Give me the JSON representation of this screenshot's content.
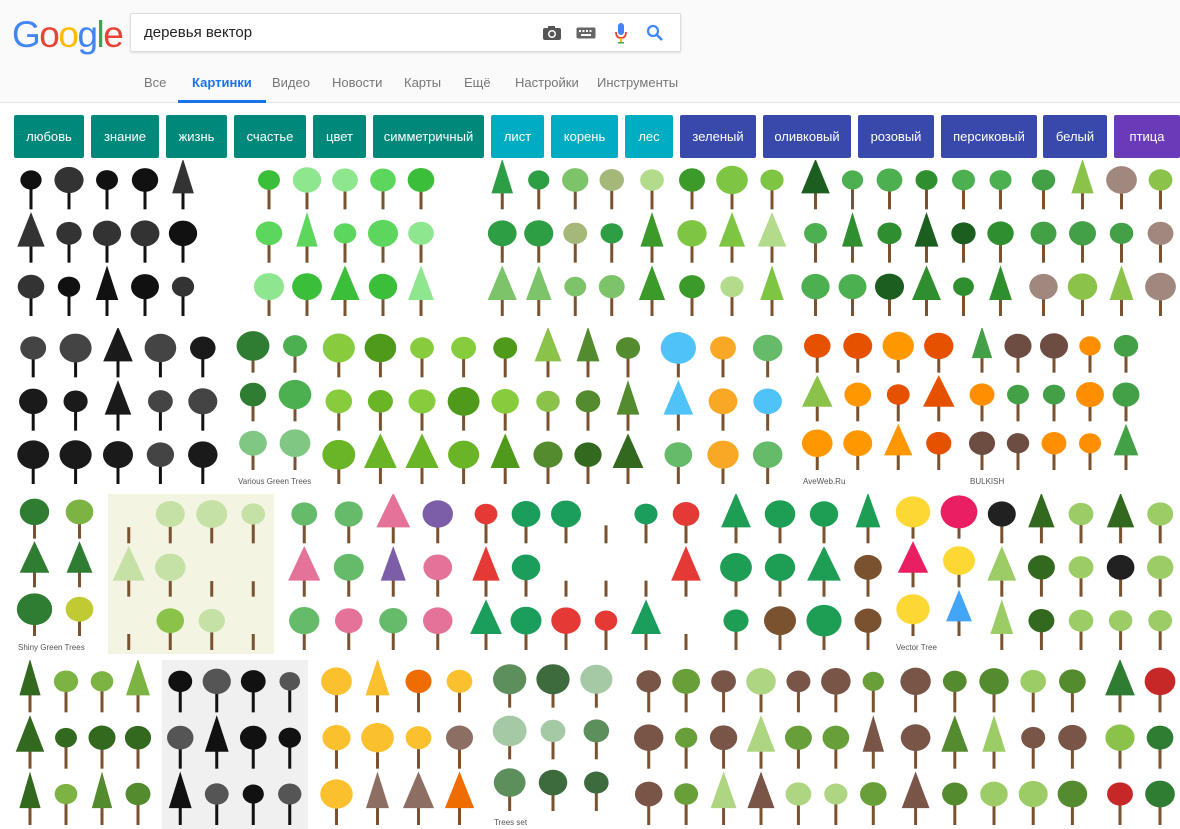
{
  "logo": {
    "letters": [
      "G",
      "o",
      "o",
      "g",
      "l",
      "e"
    ],
    "colors": [
      "#4285F4",
      "#EA4335",
      "#FBBC05",
      "#4285F4",
      "#34A853",
      "#EA4335"
    ]
  },
  "search": {
    "query": "деревья вектор",
    "camera_icon": "camera-icon",
    "keyboard_icon": "keyboard-icon",
    "mic_icon": "microphone-icon",
    "search_icon": "search-icon"
  },
  "tabs": [
    {
      "label": "Все",
      "active": false
    },
    {
      "label": "Картинки",
      "active": true
    },
    {
      "label": "Видео",
      "active": false
    },
    {
      "label": "Новости",
      "active": false
    },
    {
      "label": "Карты",
      "active": false
    },
    {
      "label": "Ещё",
      "active": false
    },
    {
      "label": "Настройки",
      "active": false
    },
    {
      "label": "Инструменты",
      "active": false
    }
  ],
  "chips": [
    {
      "label": "любовь",
      "color": "#00897B"
    },
    {
      "label": "знание",
      "color": "#00897B"
    },
    {
      "label": "жизнь",
      "color": "#00897B"
    },
    {
      "label": "счастье",
      "color": "#00897B"
    },
    {
      "label": "цвет",
      "color": "#00897B"
    },
    {
      "label": "симметричный",
      "color": "#00897B"
    },
    {
      "label": "лист",
      "color": "#00ACC1"
    },
    {
      "label": "корень",
      "color": "#00ACC1"
    },
    {
      "label": "лес",
      "color": "#00ACC1"
    },
    {
      "label": "зеленый",
      "color": "#3949AB"
    },
    {
      "label": "оливковый",
      "color": "#3949AB"
    },
    {
      "label": "розовый",
      "color": "#3949AB"
    },
    {
      "label": "персиковый",
      "color": "#3949AB"
    },
    {
      "label": "белый",
      "color": "#3949AB"
    },
    {
      "label": "птица",
      "color": "#6A3BB8"
    }
  ],
  "thumbnails": [
    {
      "style": "silhouette-black",
      "palette": [
        "#111111",
        "#333333"
      ],
      "caption": ""
    },
    {
      "style": "cartoon-green",
      "palette": [
        "#5cd65c",
        "#3bbf3b",
        "#8ee68e"
      ],
      "caption": ""
    },
    {
      "style": "mixed-green",
      "palette": [
        "#2e9e45",
        "#7cc36a",
        "#a4b87a"
      ],
      "caption": ""
    },
    {
      "style": "willow-green",
      "palette": [
        "#7dc542",
        "#3c9a2a",
        "#b2dc8b"
      ],
      "caption": ""
    },
    {
      "style": "many-green",
      "palette": [
        "#2f8f2f",
        "#4caf50",
        "#1b5e20"
      ],
      "caption": ""
    },
    {
      "style": "bonsai-green",
      "palette": [
        "#43a047",
        "#8bc34a",
        "#a1887f"
      ],
      "caption": ""
    },
    {
      "style": "silhouette-reflect",
      "palette": [
        "#1a1a1a",
        "#444444"
      ],
      "caption": ""
    },
    {
      "style": "small-green",
      "palette": [
        "#4caf50",
        "#2e7d32",
        "#81c784"
      ],
      "caption": "Various Green Trees"
    },
    {
      "style": "lime-green",
      "palette": [
        "#6ab526",
        "#4f9a1a",
        "#86cc3c"
      ],
      "caption": ""
    },
    {
      "style": "grid-green",
      "palette": [
        "#558b2f",
        "#8bc34a",
        "#33691e"
      ],
      "caption": ""
    },
    {
      "style": "autumn-mix",
      "palette": [
        "#f9a825",
        "#66bb6a",
        "#4fc3f7"
      ],
      "caption": ""
    },
    {
      "style": "autumn-green",
      "palette": [
        "#8bc34a",
        "#ff9800",
        "#e65100"
      ],
      "caption": "AveWeb.Ru"
    },
    {
      "style": "seasons",
      "palette": [
        "#6d4c41",
        "#43a047",
        "#ff8f00"
      ],
      "caption": "BULKISH"
    },
    {
      "style": "shiny-green",
      "palette": [
        "#7cb342",
        "#2e7d32",
        "#c0ca33"
      ],
      "caption": "Shiny Green Trees"
    },
    {
      "style": "flat-cream",
      "palette": [
        "#8bc34a",
        "#c5e1a5",
        "#f4f4e3"
      ],
      "caption": ""
    },
    {
      "style": "pink-purple",
      "palette": [
        "#e57399",
        "#7b5ea7",
        "#66bb6a"
      ],
      "caption": ""
    },
    {
      "style": "emblem-green",
      "palette": [
        "#1b9e5b",
        "#e53935",
        "#ffffff"
      ],
      "caption": ""
    },
    {
      "style": "green-tree-big",
      "palette": [
        "#1e9e55",
        "#7a5230"
      ],
      "caption": ""
    },
    {
      "style": "colorful-dots",
      "palette": [
        "#e91e63",
        "#fdd835",
        "#42a5f5"
      ],
      "caption": "Vector Tree"
    },
    {
      "style": "curly-green",
      "palette": [
        "#9ccc65",
        "#33691e",
        "#212121"
      ],
      "caption": ""
    },
    {
      "style": "realistic-green",
      "palette": [
        "#558b2f",
        "#7cb342",
        "#33691e"
      ],
      "caption": ""
    },
    {
      "style": "round-black",
      "palette": [
        "#111111",
        "#555555"
      ],
      "caption": ""
    },
    {
      "style": "autumn-yellow",
      "palette": [
        "#fbc02d",
        "#ef6c00",
        "#8d6e63"
      ],
      "caption": ""
    },
    {
      "style": "topview-green",
      "palette": [
        "#5d8f5d",
        "#3e6b3e",
        "#a5c9a5"
      ],
      "caption": "Trees set"
    },
    {
      "style": "birch-green",
      "palette": [
        "#689f38",
        "#aed581",
        "#795548"
      ],
      "caption": ""
    },
    {
      "style": "sticker-green",
      "palette": [
        "#558b2f",
        "#9ccc65",
        "#795548"
      ],
      "caption": ""
    },
    {
      "style": "realistic-mixed",
      "palette": [
        "#2e7d32",
        "#c62828",
        "#8bc34a"
      ],
      "caption": ""
    },
    {
      "style": "cartoon-brown",
      "palette": [
        "#8bc34a",
        "#8d6e63",
        "#a5d6a7"
      ],
      "caption": ""
    }
  ]
}
